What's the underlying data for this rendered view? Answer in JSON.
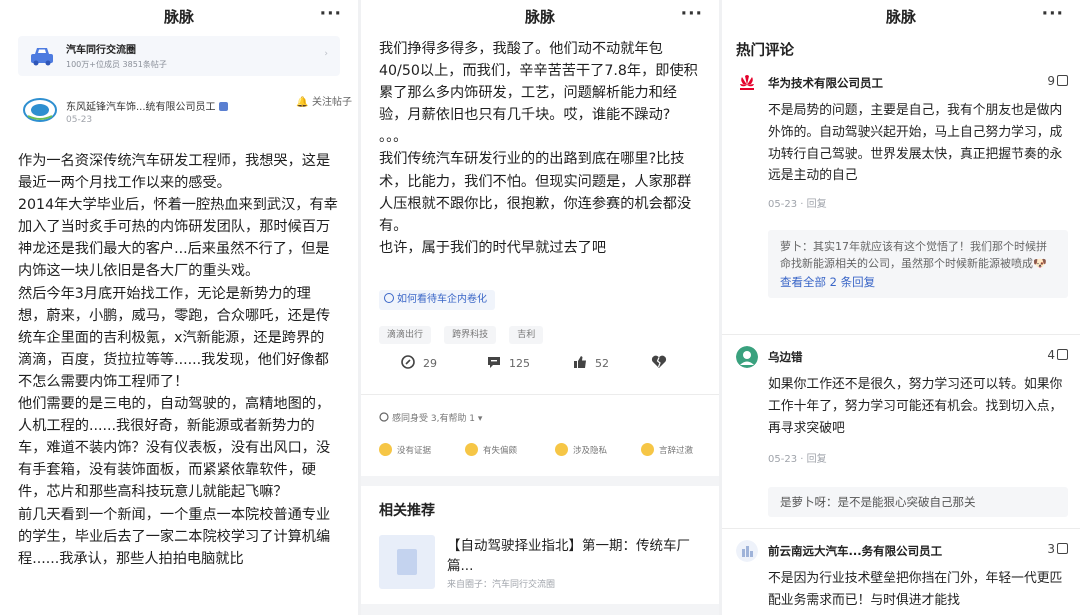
{
  "app": {
    "title": "脉脉",
    "more": "···"
  },
  "panel1": {
    "circle": {
      "name": "汽车同行交流圈",
      "stats": "100万+位成员  3851条帖子",
      "arrow": "›"
    },
    "author": {
      "name": "东风延锋汽车饰...统有限公司员工",
      "date": "05-23"
    },
    "follow": "🔔 关注帖子",
    "paragraphs": [
      "作为一名资深传统汽车研发工程师，我想哭，这是最近一两个月找工作以来的感受。",
      "2014年大学毕业后，怀着一腔热血来到武汉，有幸加入了当时炙手可热的内饰研发团队，那时候百万神龙还是我们最大的客户...后来虽然不行了，但是内饰这一块儿依旧是各大厂的重头戏。",
      "然后今年3月底开始找工作，无论是新势力的理想，蔚来，小鹏，威马，零跑，合众哪吒，还是传统车企里面的吉利极氪，x汽新能源，还是跨界的滴滴，百度，货拉拉等等......我发现，他们好像都不怎么需要内饰工程师了！",
      "他们需要的是三电的，自动驾驶的，高精地图的，人机工程的......我很好奇，新能源或者新势力的车，难道不装内饰？没有仪表板，没有出风口，没有手套箱，没有装饰面板，而紧紧依靠软件，硬件，芯片和那些高科技玩意儿就能起飞嘛？",
      "前几天看到一个新闻，一个重点一本院校普通专业的学生，毕业后去了一家二本院校学习了计算机编程......我承认，那些人拍拍电脑就比"
    ]
  },
  "panel2": {
    "paragraphs": [
      "我们挣得多得多，我酸了。他们动不动就年包40/50以上，而我们，辛辛苦苦干了7.8年，即使积累了那么多内饰研发，工艺，问题解析能力和经验，月薪依旧也只有几千块。哎，谁能不躁动?",
      "。。。",
      "我们传统汽车研发行业的的出路到底在哪里?比技术，比能力，我们不怕。但现实问题是，人家那群人压根就不跟你比，很抱歉，你连参赛的机会都没有。",
      "也许，属于我们的时代早就过去了吧"
    ],
    "topic": "如何看待车企内卷化",
    "tags": [
      "滴滴出行",
      "跨界科技",
      "吉利"
    ],
    "actions": {
      "edit": "29",
      "comment": "125",
      "like": "52",
      "dislike": ""
    },
    "feel": "感同身受 3,有帮助 1 ▾",
    "reactions": [
      "没有证据",
      "有失偏颇",
      "涉及隐私",
      "言辞过激"
    ],
    "recommend": {
      "title": "相关推荐",
      "item_title": "【自动驾驶择业指北】第一期：传统车厂篇...",
      "item_source": "来自圈子：汽车同行交流圈"
    }
  },
  "panel3": {
    "title": "热门评论",
    "comments": [
      {
        "name": "华为技术有限公司员工",
        "likes": "9",
        "text": "不是局势的问题，主要是自己，我有个朋友也是做内外饰的。自动驾驶兴起开始，马上自己努力学习，成功转行自己驾驶。世界发展太快，真正把握节奏的永远是主动的自己",
        "meta": "05-23 · 回复",
        "reply": "萝卜：其实17年就应该有这个觉悟了！我们那个时候拼命找新能源相关的公司，虽然那个时候新能源被喷成🐶",
        "reply_more": "查看全部 2 条回复"
      },
      {
        "name": "乌边错",
        "likes": "4",
        "text": "如果你工作还不是很久，努力学习还可以转。如果你工作十年了，努力学习可能还有机会。找到切入点，再寻求突破吧",
        "meta": "05-23 · 回复",
        "reply": "是萝卜呀：是不是能狠心突破自己那关"
      },
      {
        "name": "前云南远大汽车...务有限公司员工",
        "likes": "3",
        "text": "不是因为行业技术壁垒把你挡在门外，年轻一代更匹配业务需求而已！与时俱进才能找"
      }
    ]
  },
  "colors": {
    "accent": "#3a66c7",
    "huawei": "#e4002b",
    "green": "#3aa17e"
  }
}
